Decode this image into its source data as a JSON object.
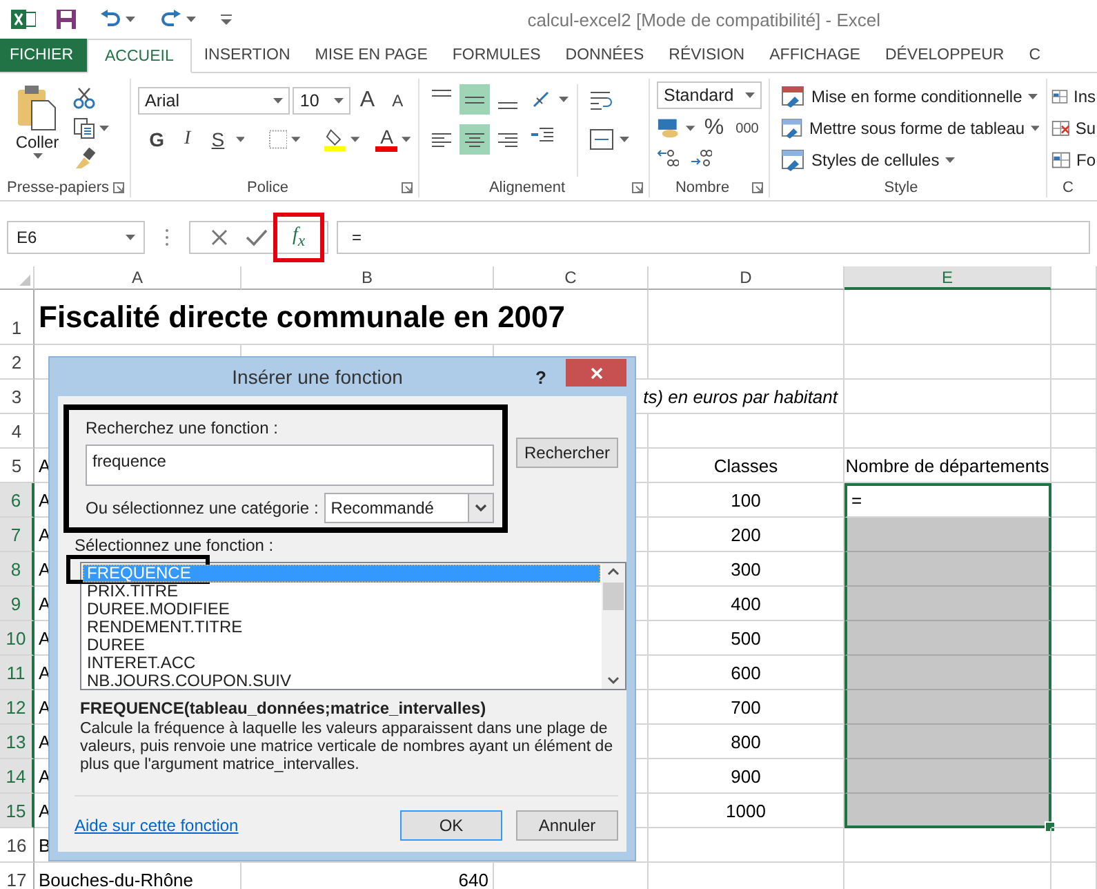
{
  "window": {
    "title": "calcul-excel2  [Mode de compatibilité] - Excel"
  },
  "tabs": [
    {
      "label": "FICHIER",
      "kind": "file",
      "selected": false
    },
    {
      "label": "ACCUEIL",
      "kind": "tab",
      "selected": true
    },
    {
      "label": "INSERTION",
      "kind": "tab",
      "selected": false
    },
    {
      "label": "MISE EN PAGE",
      "kind": "tab",
      "selected": false
    },
    {
      "label": "FORMULES",
      "kind": "tab",
      "selected": false
    },
    {
      "label": "DONNÉES",
      "kind": "tab",
      "selected": false
    },
    {
      "label": "RÉVISION",
      "kind": "tab",
      "selected": false
    },
    {
      "label": "AFFICHAGE",
      "kind": "tab",
      "selected": false
    },
    {
      "label": "DÉVELOPPEUR",
      "kind": "tab",
      "selected": false
    },
    {
      "label": "C",
      "kind": "tab",
      "selected": false
    }
  ],
  "ribbon": {
    "clipboard": {
      "paste_label": "Coller",
      "group_label": "Presse-papiers"
    },
    "font": {
      "family": "Arial",
      "size": "10",
      "grow": "A",
      "shrink": "A",
      "style_buttons": [
        "G",
        "I",
        "S"
      ],
      "color_button": "A",
      "group_label": "Police"
    },
    "alignment": {
      "buttons": [
        {
          "kind": "top",
          "selected": false
        },
        {
          "kind": "middle",
          "selected": true
        },
        {
          "kind": "bottom",
          "selected": false
        },
        {
          "kind": "left",
          "selected": false
        },
        {
          "kind": "center",
          "selected": true
        },
        {
          "kind": "right",
          "selected": false
        }
      ],
      "group_label": "Alignement"
    },
    "number": {
      "format": "Standard",
      "percent": "%",
      "thousands": "000",
      "group_label": "Nombre"
    },
    "style": {
      "items": [
        "Mise en forme conditionnelle",
        "Mettre sous forme de tableau",
        "Styles de cellules"
      ],
      "group_label": "Style"
    },
    "cells": {
      "items": [
        "Ins",
        "Su",
        "Fo"
      ],
      "group_label": "C"
    }
  },
  "formula_bar": {
    "name_box": "E6",
    "fx": "f$_{x}$",
    "fx_highlighted": true,
    "content": "="
  },
  "sheet": {
    "columns": [
      {
        "label": "A",
        "selected": false
      },
      {
        "label": "B",
        "selected": false
      },
      {
        "label": "C",
        "selected": false
      },
      {
        "label": "D",
        "selected": false
      },
      {
        "label": "E",
        "selected": true
      }
    ],
    "rows": [
      {
        "label": "1",
        "kind": "title",
        "selected": false,
        "A": "Fiscalité directe communale en 2007"
      },
      {
        "label": "2",
        "kind": "data",
        "selected": false
      },
      {
        "label": "3",
        "kind": "note",
        "selected": false,
        "C": "ts) en euros par habitant"
      },
      {
        "label": "4",
        "kind": "data",
        "selected": false
      },
      {
        "label": "5",
        "kind": "data",
        "selected": false,
        "A": "A",
        "D": "Classes",
        "E": "Nombre de départements"
      },
      {
        "label": "6",
        "kind": "data",
        "selected": true,
        "A": "A",
        "D": "100",
        "E": "="
      },
      {
        "label": "7",
        "kind": "data",
        "selected": true,
        "A": "A",
        "D": "200"
      },
      {
        "label": "8",
        "kind": "data",
        "selected": true,
        "A": "A",
        "D": "300"
      },
      {
        "label": "9",
        "kind": "data",
        "selected": true,
        "A": "A",
        "D": "400"
      },
      {
        "label": "10",
        "kind": "data",
        "selected": true,
        "A": "A",
        "D": "500"
      },
      {
        "label": "11",
        "kind": "data",
        "selected": true,
        "A": "A",
        "D": "600"
      },
      {
        "label": "12",
        "kind": "data",
        "selected": true,
        "A": "A",
        "D": "700"
      },
      {
        "label": "13",
        "kind": "data",
        "selected": true,
        "A": "A",
        "D": "800"
      },
      {
        "label": "14",
        "kind": "data",
        "selected": true,
        "A": "A",
        "D": "900"
      },
      {
        "label": "15",
        "kind": "data",
        "selected": true,
        "A": "A",
        "D": "1000"
      },
      {
        "label": "16",
        "kind": "data",
        "selected": false,
        "A": "B"
      },
      {
        "label": "17",
        "kind": "data",
        "selected": false,
        "A": "Bouches-du-Rhône",
        "B": "640"
      }
    ]
  },
  "dialog": {
    "title": "Insérer une fonction",
    "help": "?",
    "search_highlighted": true,
    "search_label": "Recherchez une fonction :",
    "search_value": "frequence",
    "search_button": "Rechercher",
    "category_label": "Ou sélectionnez une catégorie :",
    "category": "Recommandé",
    "list_label": "Sélectionnez une fonction :",
    "functions": [
      {
        "name": "FREQUENCE",
        "selected": true,
        "highlighted": true
      },
      {
        "name": "PRIX.TITRE",
        "selected": false,
        "highlighted": false
      },
      {
        "name": "DUREE.MODIFIEE",
        "selected": false,
        "highlighted": false
      },
      {
        "name": "RENDEMENT.TITRE",
        "selected": false,
        "highlighted": false
      },
      {
        "name": "DUREE",
        "selected": false,
        "highlighted": false
      },
      {
        "name": "INTERET.ACC",
        "selected": false,
        "highlighted": false
      },
      {
        "name": "NB.JOURS.COUPON.SUIV",
        "selected": false,
        "highlighted": false
      }
    ],
    "signature": "FREQUENCE(tableau_données;matrice_intervalles)",
    "description": "Calcule la fréquence à laquelle les valeurs apparaissent dans une plage de valeurs, puis renvoie une matrice verticale de nombres ayant un élément de plus que l'argument matrice_intervalles.",
    "help_link": "Aide sur cette fonction",
    "buttons": [
      {
        "label": "OK",
        "kind": "default"
      },
      {
        "label": "Annuler",
        "kind": "normal"
      }
    ]
  }
}
